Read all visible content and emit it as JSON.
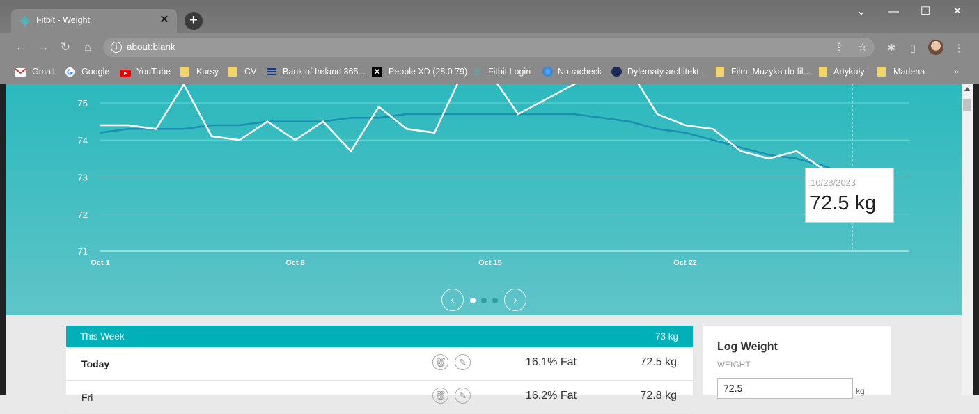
{
  "browser": {
    "tab_title": "Fitbit - Weight",
    "tab_close": "✕",
    "new_tab": "+",
    "url": "about:blank",
    "bookmarks": [
      {
        "label": "Gmail"
      },
      {
        "label": "Google"
      },
      {
        "label": "YouTube"
      },
      {
        "label": "Kursy"
      },
      {
        "label": "CV"
      },
      {
        "label": "Bank of Ireland 365..."
      },
      {
        "label": "People XD (28.0.79)"
      },
      {
        "label": "Fitbit Login"
      },
      {
        "label": "Nutracheck"
      },
      {
        "label": "Dylematy architekt..."
      },
      {
        "label": "Film, Muzyka do fil..."
      },
      {
        "label": "Artykuły"
      },
      {
        "label": "Marlena"
      }
    ]
  },
  "chart_data": {
    "type": "line",
    "y_ticks": [
      "75",
      "74",
      "73",
      "72",
      "71"
    ],
    "x_ticks": [
      "Oct 1",
      "Oct 8",
      "Oct 15",
      "Oct 22"
    ],
    "ylim": [
      71,
      75.5
    ],
    "series": [
      {
        "role": "weight",
        "color": "#ffffff",
        "x": [
          1,
          2,
          3,
          4,
          5,
          6,
          7,
          8,
          9,
          10,
          11,
          12,
          13,
          14,
          15,
          16,
          17,
          18,
          19,
          20,
          21,
          22,
          23,
          24,
          25,
          26,
          27,
          28
        ],
        "values": [
          74.4,
          74.4,
          74.3,
          75.5,
          74.1,
          74.0,
          74.5,
          74.0,
          74.5,
          73.7,
          74.9,
          74.3,
          74.2,
          75.8,
          75.8,
          74.7,
          75.1,
          75.5,
          75.9,
          75.9,
          74.7,
          74.4,
          74.3,
          73.7,
          73.5,
          73.7,
          73.2,
          72.5
        ]
      },
      {
        "role": "trend",
        "color": "#1a8fb0",
        "x": [
          1,
          2,
          3,
          4,
          5,
          6,
          7,
          8,
          9,
          10,
          11,
          12,
          13,
          14,
          15,
          16,
          17,
          18,
          19,
          20,
          21,
          22,
          23,
          24,
          25,
          26,
          27,
          28,
          29
        ],
        "values": [
          74.2,
          74.3,
          74.3,
          74.3,
          74.4,
          74.4,
          74.5,
          74.5,
          74.5,
          74.6,
          74.6,
          74.7,
          74.7,
          74.7,
          74.7,
          74.7,
          74.7,
          74.7,
          74.6,
          74.5,
          74.3,
          74.2,
          74.0,
          73.8,
          73.6,
          73.5,
          73.3,
          73.0,
          72.7
        ]
      }
    ],
    "grid": true,
    "tooltip": {
      "date": "10/28/2023",
      "value": "72.5 kg"
    }
  },
  "pager": {
    "prev": "‹",
    "next": "›",
    "pages": 3,
    "active": 0
  },
  "week": {
    "title": "This Week",
    "total": "73 kg",
    "rows": [
      {
        "day": "Today",
        "fat": "16.1% Fat",
        "kg": "72.5 kg"
      },
      {
        "day": "Fri",
        "fat": "16.2% Fat",
        "kg": "72.8 kg"
      }
    ]
  },
  "log_weight": {
    "title": "Log Weight",
    "label": "WEIGHT",
    "value": "72.5",
    "unit": "kg"
  }
}
